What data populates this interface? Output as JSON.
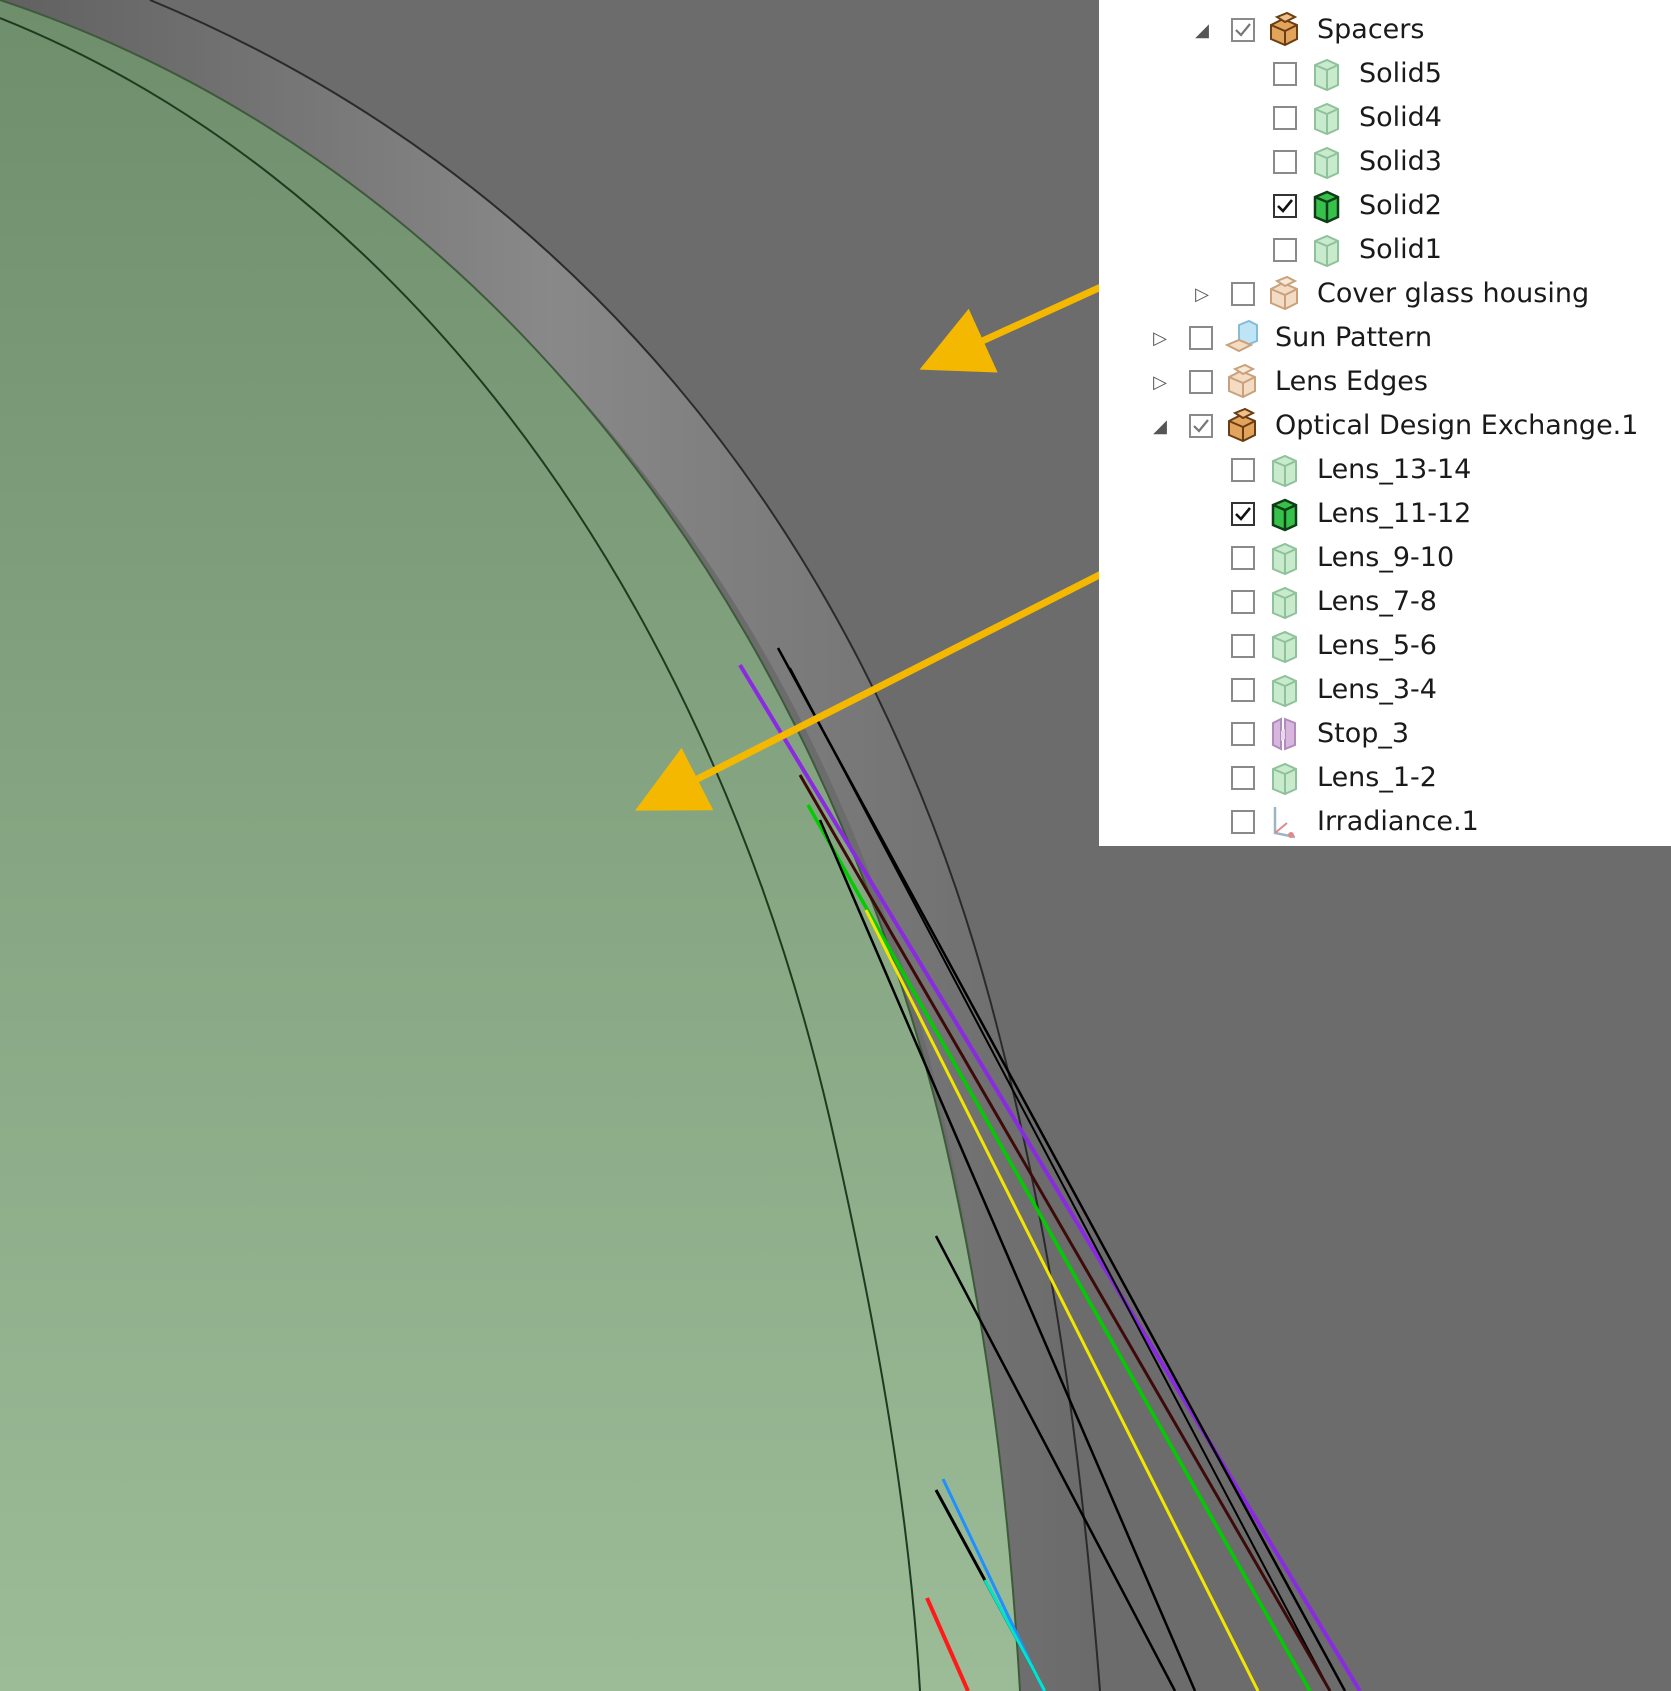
{
  "tree": {
    "items": [
      {
        "label": "Spacers",
        "expander": "expanded",
        "checked": "partial",
        "icon": "product-assembly-icon",
        "depth": 2
      },
      {
        "label": "Solid5",
        "expander": "none",
        "checked": "unchecked",
        "icon": "solid-body-icon",
        "depth": 3
      },
      {
        "label": "Solid4",
        "expander": "none",
        "checked": "unchecked",
        "icon": "solid-body-icon",
        "depth": 3
      },
      {
        "label": "Solid3",
        "expander": "none",
        "checked": "unchecked",
        "icon": "solid-body-icon",
        "depth": 3
      },
      {
        "label": "Solid2",
        "expander": "none",
        "checked": "checked",
        "icon": "solid-body-active-icon",
        "depth": 3
      },
      {
        "label": "Solid1",
        "expander": "none",
        "checked": "unchecked",
        "icon": "solid-body-icon",
        "depth": 3
      },
      {
        "label": "Cover glass housing",
        "expander": "collapsed",
        "checked": "unchecked",
        "icon": "product-assembly-faded-icon",
        "depth": 2
      },
      {
        "label": "Sun Pattern",
        "expander": "collapsed",
        "checked": "unchecked",
        "icon": "light-source-icon",
        "depth": 1
      },
      {
        "label": "Lens Edges",
        "expander": "collapsed",
        "checked": "unchecked",
        "icon": "product-assembly-faded-icon",
        "depth": 1
      },
      {
        "label": "Optical Design Exchange.1",
        "expander": "expanded",
        "checked": "partial",
        "icon": "product-assembly-icon",
        "depth": 1
      },
      {
        "label": "Lens_13-14",
        "expander": "none",
        "checked": "unchecked",
        "icon": "solid-body-icon",
        "depth": 2
      },
      {
        "label": "Lens_11-12",
        "expander": "none",
        "checked": "checked",
        "icon": "solid-body-active-icon",
        "depth": 2
      },
      {
        "label": "Lens_9-10",
        "expander": "none",
        "checked": "unchecked",
        "icon": "solid-body-icon",
        "depth": 2
      },
      {
        "label": "Lens_7-8",
        "expander": "none",
        "checked": "unchecked",
        "icon": "solid-body-icon",
        "depth": 2
      },
      {
        "label": "Lens_5-6",
        "expander": "none",
        "checked": "unchecked",
        "icon": "solid-body-icon",
        "depth": 2
      },
      {
        "label": "Lens_3-4",
        "expander": "none",
        "checked": "unchecked",
        "icon": "solid-body-icon",
        "depth": 2
      },
      {
        "label": "Stop_3",
        "expander": "none",
        "checked": "unchecked",
        "icon": "aperture-stop-icon",
        "depth": 2
      },
      {
        "label": "Lens_1-2",
        "expander": "none",
        "checked": "unchecked",
        "icon": "solid-body-icon",
        "depth": 2
      },
      {
        "label": "Irradiance.1",
        "expander": "none",
        "checked": "unchecked",
        "icon": "sensor-axis-icon",
        "depth": 2
      }
    ]
  },
  "viewport": {
    "scene": "3d-optical-model",
    "colors": {
      "background": "#6c6c6c",
      "lens": "#8fb08c",
      "spacer": "#7d7d7d",
      "annotation_arrow": "#f5b800"
    },
    "ray_colors": [
      "#8a2be2",
      "#000000",
      "#3d0a0a",
      "#00cc00",
      "#f2e600",
      "#1e90ff",
      "#00e6c8",
      "#ff1a1a"
    ]
  }
}
